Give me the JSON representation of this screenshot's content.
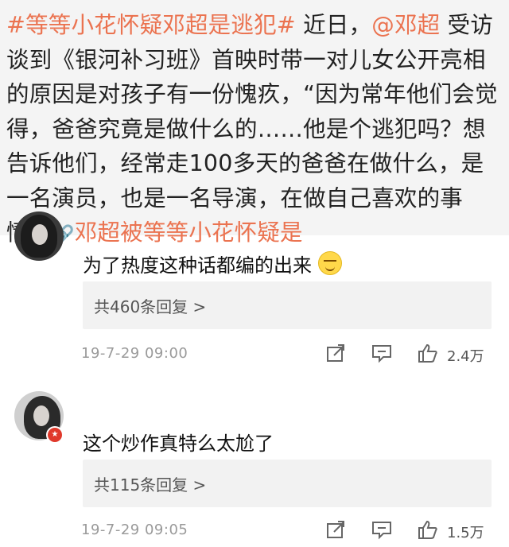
{
  "post": {
    "topic_tag": "#等等小花怀疑邓超是逃犯#",
    "text_part1": " 近日，",
    "mention": "@邓超",
    "text_part2": " 受访谈到《银河补习班》首映时带一对儿女公开亮相的原因是对孩子有一份愧疚，“因为常年他们会觉得，爸爸究竟是做什么的……他是个逃犯吗？想告诉他们，经常走100多天的爸爸在做什么，是一名演员，也是一名导演，在做自己喜欢的事情。”",
    "link_icon": "link-icon",
    "link_text": "邓超被等等小花怀疑是"
  },
  "comments": [
    {
      "text": "为了热度这种话都编的出来",
      "emoji": "grimace-emoji",
      "reply_label": "共460条回复 >",
      "time": "19-7-29 09:00",
      "likes": "2.4万"
    },
    {
      "text": "这个炒作真特么太尬了",
      "reply_label": "共115条回复 >",
      "time": "19-7-29 09:05",
      "likes": "1.5万"
    }
  ],
  "icons": {
    "share": "share-icon",
    "reply": "comment-icon",
    "like": "thumbs-up-icon"
  },
  "colors": {
    "accent": "#eb7350",
    "timestamp": "#9a9a9a",
    "reply_box": "#f2f2f2",
    "badge": "#e0392b"
  }
}
